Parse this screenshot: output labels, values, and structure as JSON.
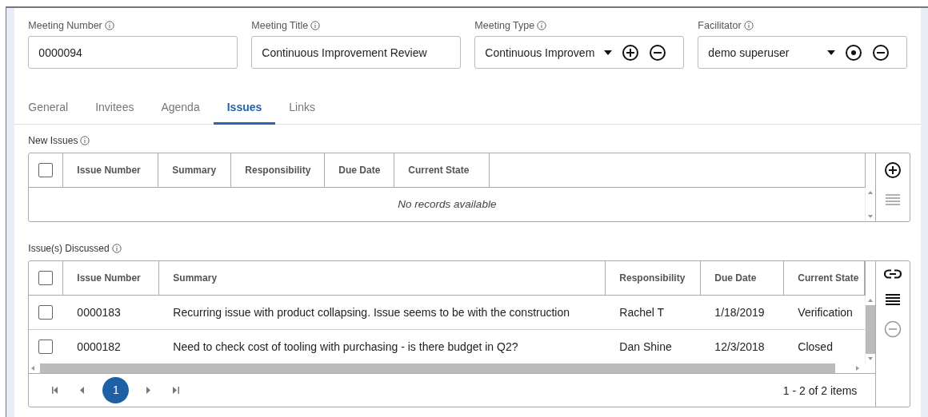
{
  "fields": [
    {
      "kind": "text",
      "label": "Meeting Number",
      "value": "0000094"
    },
    {
      "kind": "text",
      "label": "Meeting Title",
      "value": "Continuous Improvement Review"
    },
    {
      "kind": "dropdown",
      "label": "Meeting Type",
      "value": "Continuous Improvem"
    },
    {
      "kind": "dropdown",
      "label": "Facilitator",
      "value": "demo superuser"
    }
  ],
  "tabs": [
    {
      "label": "General",
      "selected": false
    },
    {
      "label": "Invitees",
      "selected": false
    },
    {
      "label": "Agenda",
      "selected": false
    },
    {
      "label": "Issues",
      "selected": true
    },
    {
      "label": "Links",
      "selected": false
    }
  ],
  "new_issues": {
    "title": "New Issues",
    "columns": [
      "Issue Number",
      "Summary",
      "Responsibility",
      "Due Date",
      "Current State"
    ],
    "header_checked": false,
    "empty_text": "No records available",
    "actions": [
      {
        "disabled": false
      },
      {
        "disabled": true
      }
    ]
  },
  "issues_discussed": {
    "title": "Issue(s) Discussed",
    "columns": [
      "Issue Number",
      "Summary",
      "Responsibility",
      "Due Date",
      "Current State"
    ],
    "header_checked": false,
    "rows": [
      {
        "checked": false,
        "cells": [
          "0000183",
          "Recurring issue with product collapsing. Issue seems to be with the construction",
          "Rachel T",
          "1/18/2019",
          "Verification"
        ]
      },
      {
        "checked": false,
        "cells": [
          "0000182",
          "Need to check cost of tooling with purchasing - is there budget in Q2?",
          "Dan Shine",
          "12/3/2018",
          "Closed"
        ]
      }
    ],
    "pages": [
      {
        "label": "1",
        "selected": true
      }
    ],
    "page_info": "1 - 2 of 2 items",
    "actions": [
      {
        "disabled": false
      },
      {
        "disabled": false
      },
      {
        "disabled": true
      }
    ]
  }
}
